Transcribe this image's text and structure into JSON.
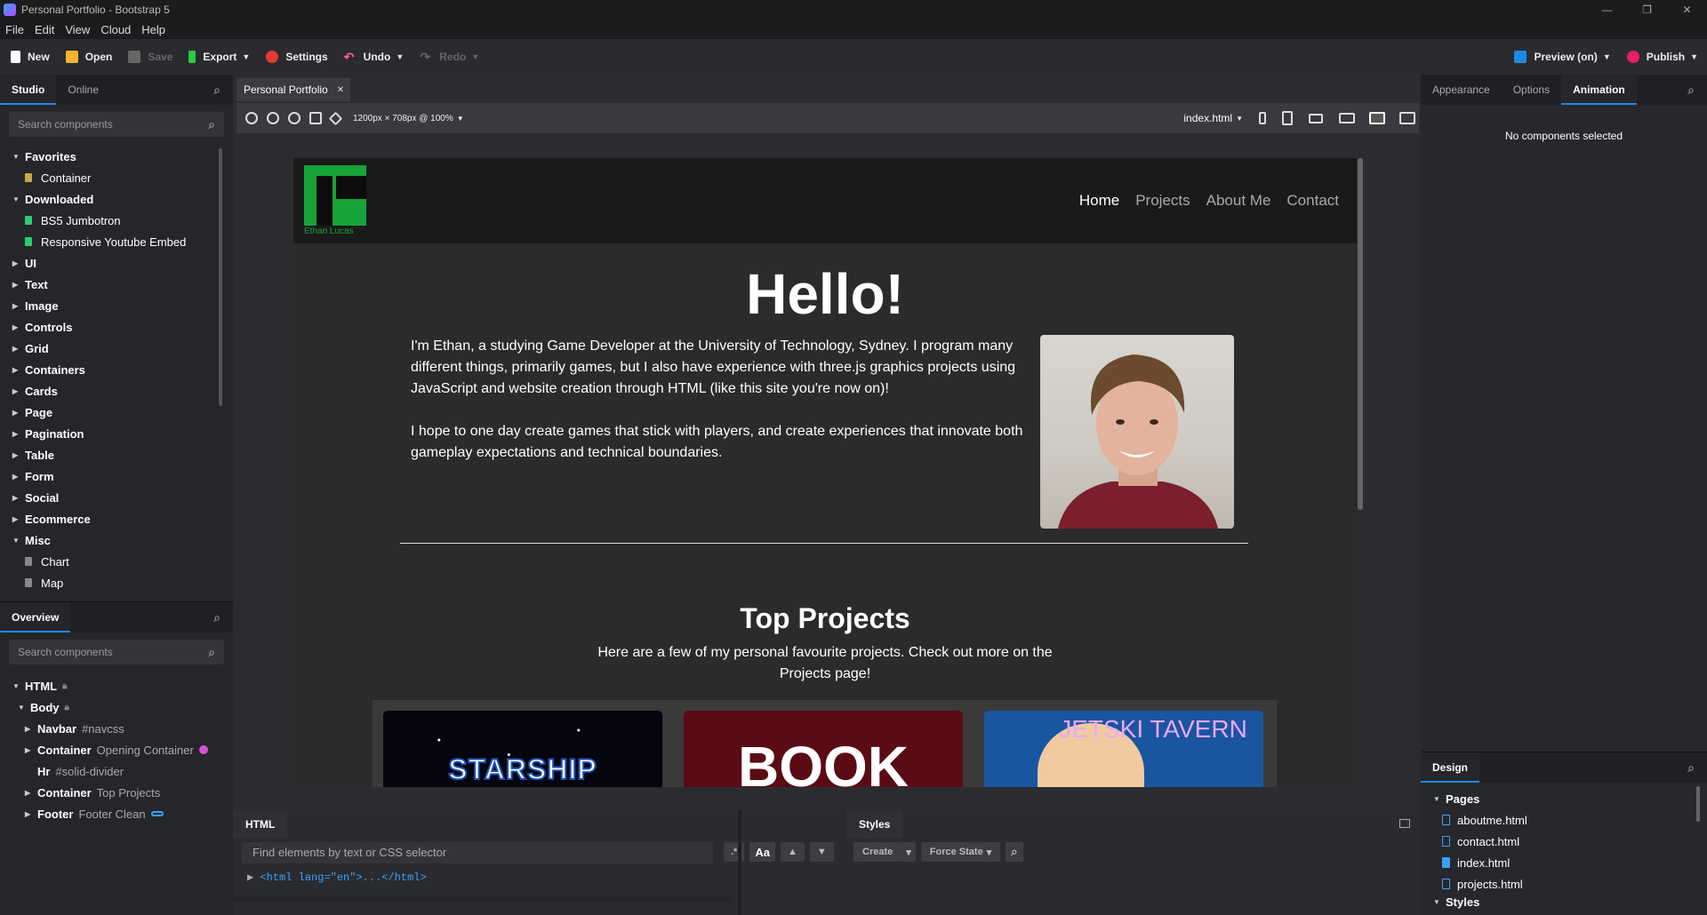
{
  "window": {
    "title": "Personal Portfolio - Bootstrap 5",
    "controls": [
      "—",
      "❐",
      "✕"
    ]
  },
  "menu": [
    "File",
    "Edit",
    "View",
    "Cloud",
    "Help"
  ],
  "toolbar": {
    "new": "New",
    "open": "Open",
    "save": "Save",
    "export": "Export",
    "settings": "Settings",
    "undo": "Undo",
    "redo": "Redo",
    "preview": "Preview (on)",
    "publish": "Publish"
  },
  "left": {
    "tabs": [
      "Studio",
      "Online"
    ],
    "search_placeholder": "Search components",
    "favorites": {
      "label": "Favorites",
      "items": [
        "Container"
      ]
    },
    "downloaded": {
      "label": "Downloaded",
      "items": [
        "BS5 Jumbotron",
        "Responsive Youtube Embed"
      ]
    },
    "groups": [
      "UI",
      "Text",
      "Image",
      "Controls",
      "Grid",
      "Containers",
      "Cards",
      "Page",
      "Pagination",
      "Table",
      "Form",
      "Social",
      "Ecommerce"
    ],
    "misc": {
      "label": "Misc",
      "items": [
        "Chart",
        "Map"
      ]
    },
    "overview": {
      "tab": "Overview",
      "search_placeholder": "Search components",
      "html": "HTML",
      "body": "Body",
      "nodes": [
        {
          "name": "Navbar",
          "extra": "#navcss"
        },
        {
          "name": "Container",
          "extra": "Opening Container"
        },
        {
          "name": "Hr",
          "extra": "#solid-divider"
        },
        {
          "name": "Container",
          "extra": "Top Projects"
        },
        {
          "name": "Footer",
          "extra": "Footer Clean"
        }
      ]
    }
  },
  "center": {
    "doc_tab": "Personal Portfolio",
    "size_label": "1200px × 708px @ 100%",
    "page_select": "index.html"
  },
  "site": {
    "logo_name": "Ethan Lucas",
    "nav": [
      "Home",
      "Projects",
      "About Me",
      "Contact"
    ],
    "hello": "Hello!",
    "intro1": "I'm Ethan, a studying Game Developer at the University of Technology, Sydney. I program many different things, primarily games, but I also have experience with three.js graphics projects using JavaScript and website creation through HTML (like this site you're now on)!",
    "intro2": "I hope to one day create games that stick with players, and create experiences that innovate both gameplay expectations and technical boundaries.",
    "projects_title": "Top Projects",
    "projects_sub": "Here are a few of my personal favourite projects. Check out more on the Projects page!",
    "cards": [
      "STARSHIP",
      "BOOK",
      "JETSKI TAVERN"
    ]
  },
  "right": {
    "tabs": [
      "Appearance",
      "Options",
      "Animation"
    ],
    "empty": "No components selected",
    "design": {
      "tab": "Design",
      "pages_label": "Pages",
      "pages": [
        "aboutme.html",
        "contact.html",
        "index.html",
        "projects.html"
      ],
      "styles_label": "Styles"
    }
  },
  "bottom": {
    "html_tab": "HTML",
    "find_placeholder": "Find elements by text or CSS selector",
    "case_btn": "Aa",
    "code_line": "<html lang=\"en\">...</html>",
    "styles_tab": "Styles",
    "create": "Create",
    "force_state": "Force State"
  }
}
